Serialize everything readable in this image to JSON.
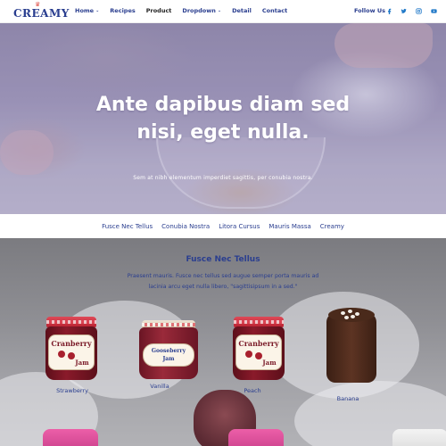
{
  "brand": {
    "name": "CREAMY",
    "crown": "♛"
  },
  "nav": {
    "items": [
      {
        "label": "Home",
        "dropdown": true,
        "caret": "⌄"
      },
      {
        "label": "Recipes",
        "dropdown": false
      },
      {
        "label": "Product",
        "dropdown": false,
        "active": true
      },
      {
        "label": "Dropdown",
        "dropdown": true,
        "caret": "⌄"
      },
      {
        "label": "Detail",
        "dropdown": false
      },
      {
        "label": "Contact",
        "dropdown": false
      }
    ],
    "follow_label": "Follow Us",
    "social": [
      "facebook-icon",
      "twitter-icon",
      "instagram-icon",
      "youtube-icon"
    ]
  },
  "hero": {
    "title": "Ante dapibus diam sed nisi, eget nulla.",
    "subtitle": "Sem at nibh elementum imperdiet sagittis, per conubia nostra."
  },
  "subnav": {
    "items": [
      "Fusce Nec Tellus",
      "Conubia Nostra",
      "Litora Cursus",
      "Mauris Massa",
      "Creamy"
    ]
  },
  "products": {
    "title": "Fusce Nec Tellus",
    "description": "Praesent mauris. Fusce nec tellus sed augue semper porta mauris ad lacinia arcu eget nulla libero, \"sagittisipsum in a sed.\"",
    "items": [
      {
        "label": "Strawberry",
        "jar_text_1": "Cranberry",
        "jar_text_2": "Jam"
      },
      {
        "label": "Vanilla",
        "jar_text_1": "Gooseberry",
        "jar_text_2": "Jam"
      },
      {
        "label": "Peach",
        "jar_text_1": "Cranberry",
        "jar_text_2": "Jam"
      },
      {
        "label": "Banana"
      }
    ]
  },
  "colors": {
    "brand": "#2a3e8f",
    "accent": "#e0574f",
    "social": "#1f78c8"
  }
}
